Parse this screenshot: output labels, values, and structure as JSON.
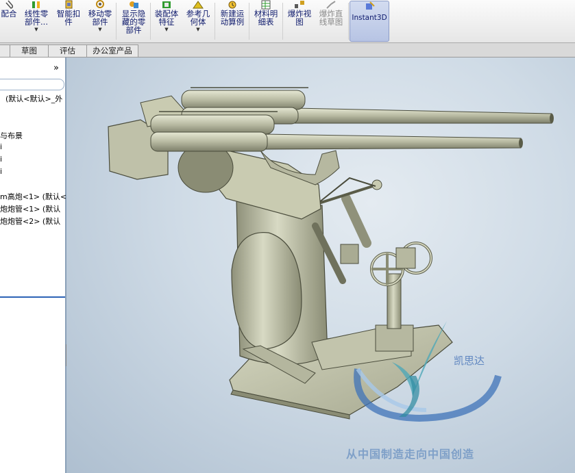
{
  "ribbon": {
    "buttons": [
      {
        "label": "配合",
        "arrow": false
      },
      {
        "label": "线性零\n部件...",
        "arrow": true
      },
      {
        "label": "智能扣\n件",
        "arrow": false
      },
      {
        "label": "移动零\n部件",
        "arrow": true
      },
      {
        "label": "显示隐\n藏的零\n部件",
        "arrow": false
      },
      {
        "label": "装配体\n特征",
        "arrow": true
      },
      {
        "label": "参考几\n何体",
        "arrow": true
      },
      {
        "label": "新建运\n动算例",
        "arrow": false
      },
      {
        "label": "材料明\n细表",
        "arrow": false
      },
      {
        "label": "爆炸视\n图",
        "arrow": false
      },
      {
        "label": "爆炸直\n线草图",
        "arrow": false,
        "disabled": true
      },
      {
        "label": "Instant3D",
        "arrow": false,
        "active": true
      }
    ]
  },
  "tabs": [
    "草图",
    "评估",
    "办公室产品"
  ],
  "tree": {
    "expand_glyph": "»",
    "items": [
      "(默认<默认>_外",
      "与布景",
      "i",
      "i",
      "i",
      "m高炮<1> (默认<",
      "炮炮管<1> (默认",
      "炮炮管<2> (默认"
    ]
  },
  "watermark": {
    "logo_text": "凯思达",
    "slogan": "从中国制造走向中国创造"
  },
  "colors": {
    "model": "#c9cbb1",
    "viewport": "#c6d3df",
    "ribbon_text": "#0e1a6c",
    "logo": "#5f86c0"
  }
}
